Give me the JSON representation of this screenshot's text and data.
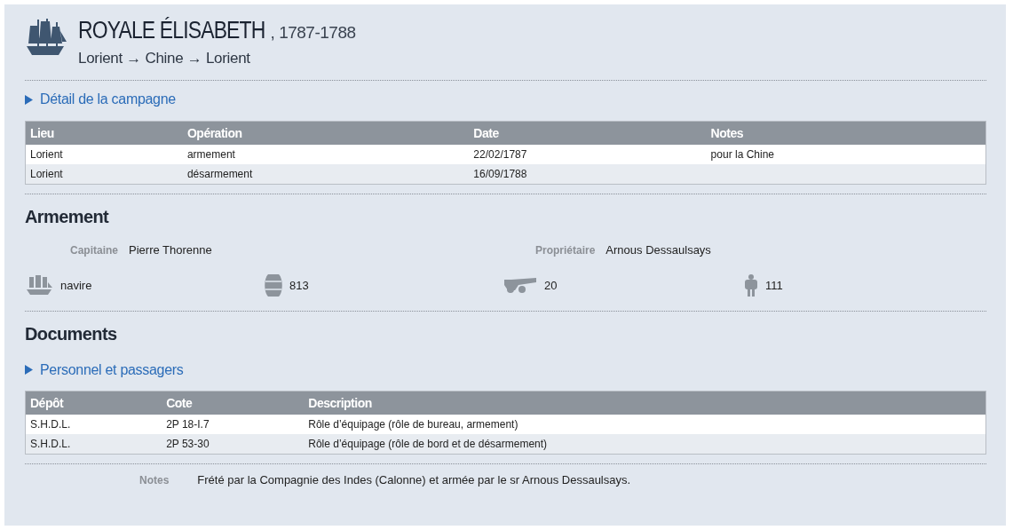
{
  "header": {
    "name": "ROYALE ÉLISABETH",
    "separator": ",",
    "years": "1787-1788",
    "route": "Lorient → Chine → Lorient"
  },
  "campaign": {
    "toggle": {
      "label": "Détail de la campagne",
      "expanded": false
    },
    "table": {
      "columns": [
        "Lieu",
        "Opération",
        "Date",
        "Notes"
      ],
      "rows": [
        [
          "Lorient",
          "armement",
          "22/02/1787",
          "pour la Chine"
        ],
        [
          "Lorient",
          "désarmement",
          "16/09/1788",
          ""
        ]
      ]
    }
  },
  "armement": {
    "title": "Armement",
    "fields": [
      {
        "label": "Capitaine",
        "value": "Pierre Thorenne"
      },
      {
        "label": "Propriétaire",
        "value": "Arnous Dessaulsays"
      }
    ],
    "stats": [
      {
        "kind": "ship",
        "value": "navire"
      },
      {
        "kind": "barrel",
        "value": "813"
      },
      {
        "kind": "cannon",
        "value": "20"
      },
      {
        "kind": "crew",
        "value": "111"
      }
    ]
  },
  "documents": {
    "title": "Documents",
    "toggle": {
      "label": "Personnel et passagers",
      "expanded": false
    },
    "table": {
      "columns": [
        "Dépôt",
        "Cote",
        "Description"
      ],
      "rows": [
        [
          "S.H.D.L.",
          "2P 18-I.7",
          "Rôle d’équipage (rôle de bureau, armement)"
        ],
        [
          "S.H.D.L.",
          "2P 53-30",
          "Rôle d’équipage (rôle de bord et de désarmement)"
        ]
      ]
    },
    "notes": {
      "label": "Notes",
      "text": "Frété par la Compagnie des Indes (Calonne) et armée par le sr Arnous Dessaulsays."
    }
  }
}
